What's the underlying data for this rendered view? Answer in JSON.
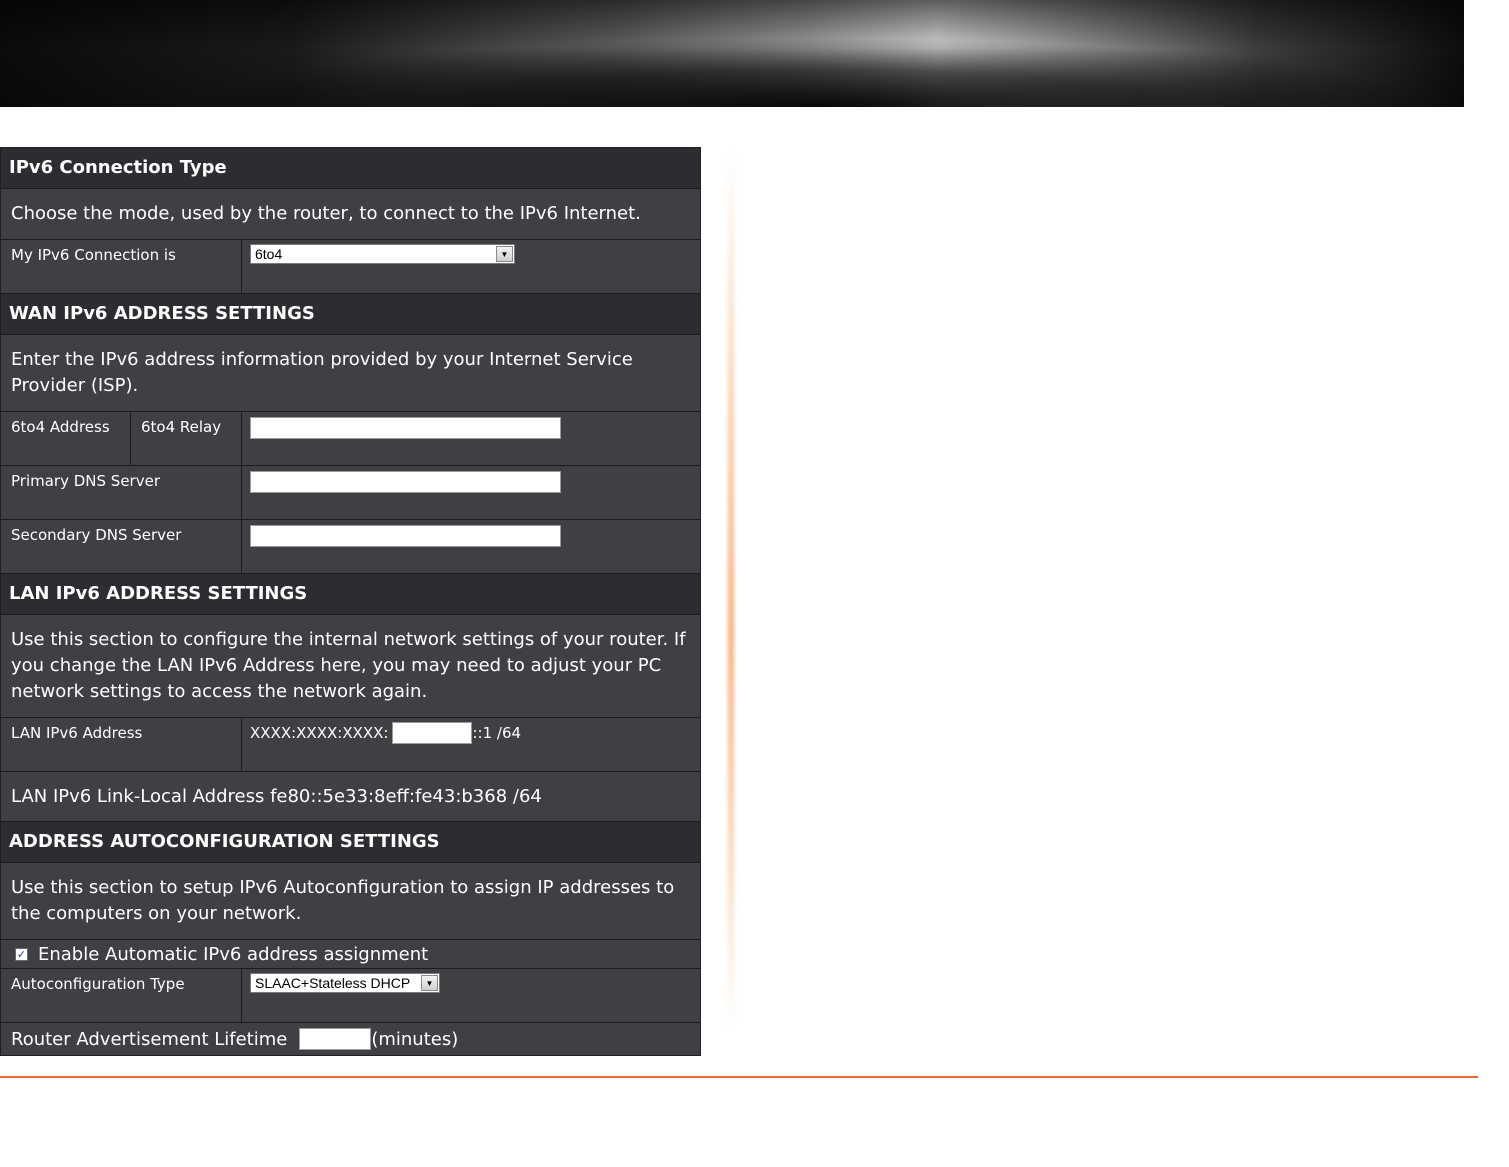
{
  "ipv6_connection": {
    "header": "IPv6 Connection Type",
    "description": "Choose the mode, used by the router, to connect to the IPv6 Internet.",
    "connection_label": "My IPv6 Connection is",
    "connection_value": "6to4"
  },
  "wan": {
    "header": "WAN IPv6 ADDRESS SETTINGS",
    "description": "Enter the IPv6 address information provided by your Internet Service Provider (ISP).",
    "address_label": "6to4 Address",
    "relay_label": "6to4 Relay",
    "relay_value": "",
    "primary_dns_label": "Primary DNS Server",
    "primary_dns_value": "",
    "secondary_dns_label": "Secondary DNS Server",
    "secondary_dns_value": ""
  },
  "lan": {
    "header": "LAN IPv6 ADDRESS SETTINGS",
    "description": "Use this section to configure the internal network settings of your router. If you change the LAN IPv6 Address here, you may need to adjust your PC network settings to access the network again.",
    "address_label": "LAN IPv6 Address",
    "address_prefix": "XXXX:XXXX:XXXX:",
    "address_value": "",
    "address_suffix": "::1 /64",
    "link_local": "LAN IPv6 Link-Local Address fe80::5e33:8eff:fe43:b368 /64"
  },
  "autoconfig": {
    "header": "ADDRESS AUTOCONFIGURATION SETTINGS",
    "description": "Use this section to setup IPv6 Autoconfiguration to assign IP addresses to the computers on your network.",
    "enable_label": "Enable Automatic IPv6 address assignment",
    "enable_checked": true,
    "type_label": "Autoconfiguration Type",
    "type_value": "SLAAC+Stateless DHCP",
    "ra_label": "Router Advertisement Lifetime",
    "ra_value": "",
    "ra_unit": "(minutes)"
  },
  "colors": {
    "panel_bg": "#3f4044",
    "header_bg": "#2c2d30",
    "accent_orange": "#e9692c"
  }
}
